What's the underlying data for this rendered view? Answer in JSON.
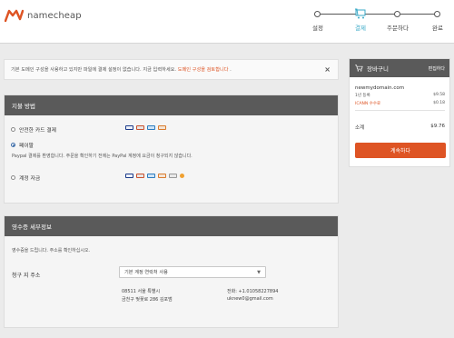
{
  "brand": {
    "name": "namecheap",
    "accent": "#de5424"
  },
  "steps": [
    {
      "label": "설정",
      "state": "done"
    },
    {
      "label": "결제",
      "state": "active"
    },
    {
      "label": "주문하다",
      "state": "pending"
    },
    {
      "label": "완료",
      "state": "pending"
    }
  ],
  "notice": {
    "text": "기본 도메인 구성을 사용하고 있지만 파일에 결제 설정이 없습니다. 지금 입력하세요.",
    "link": "도메인 구성을 검토합니다",
    "suffix": ".",
    "close_icon": "×"
  },
  "payment": {
    "heading": "지불 방법",
    "options": [
      {
        "label": "안전한 카드 결제",
        "selected": false,
        "icons": [
          "visa-icon",
          "mastercard-icon",
          "amex-icon",
          "discover-icon"
        ]
      },
      {
        "label": "페이팔",
        "selected": true,
        "description": "Paypal 결제를 환영합니다. 주문을 확인하기 전에는 PayPal 계정에 요금이 청구되지 않습니다."
      },
      {
        "label": "계정 자금",
        "selected": false,
        "icons": [
          "visa-icon",
          "mastercard-icon",
          "amex-icon",
          "discover-icon",
          "card-icon",
          "coin-icon"
        ]
      }
    ]
  },
  "billing": {
    "heading": "영수증 세부정보",
    "intro": "영수증을 드립니다. 주소를 확인하십시오.",
    "address_label": "청구 지 주소",
    "select_value": "기본 계정 연락처 사용",
    "address_lines": [
      "08511 서울 특별시",
      "금천구 벚꽃로 286 김포범"
    ],
    "phone": "전화: +1.01058227894",
    "email": "uknew0@gmail.com"
  },
  "cart": {
    "title": "장바구니",
    "edit_label": "편집하다",
    "domain": "newmydomain.com",
    "items": [
      {
        "label": "1년 등록",
        "price": "$9.58",
        "highlight": false
      },
      {
        "label": "ICANN 수수료",
        "price": "$0.18",
        "highlight": true
      }
    ],
    "subtotal_label": "소계",
    "subtotal_value": "$9.76",
    "continue_label": "계속하다"
  }
}
